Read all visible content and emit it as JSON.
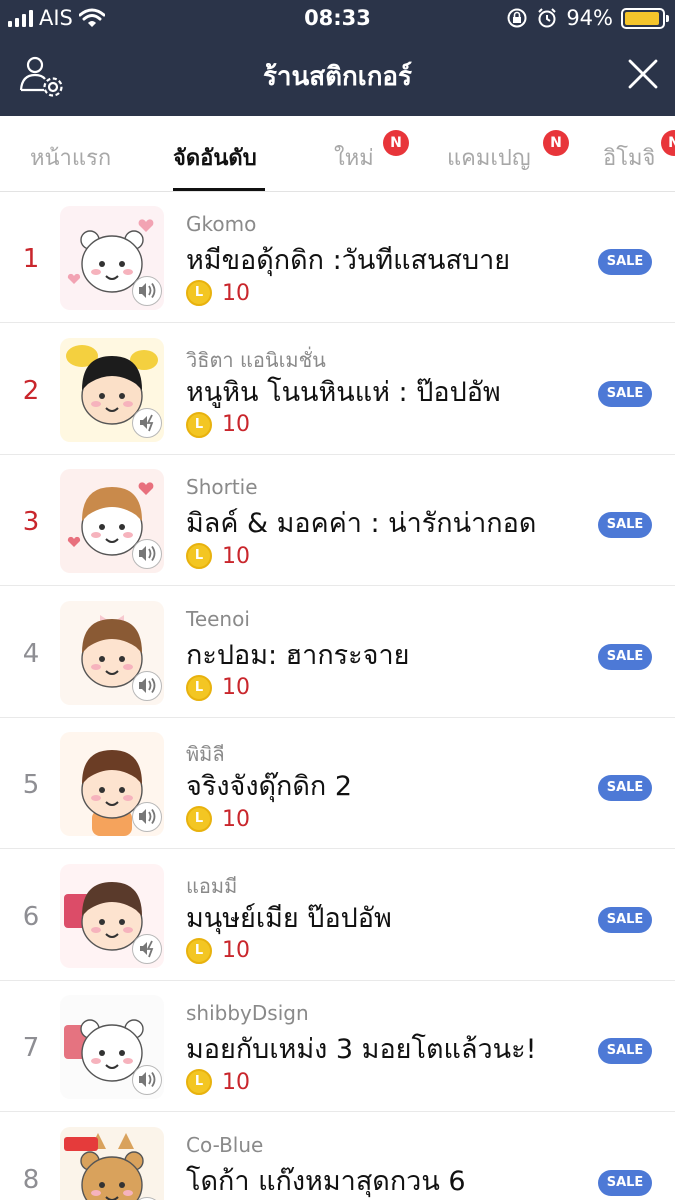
{
  "status_bar": {
    "carrier": "AIS",
    "time": "08:33",
    "battery_percent_label": "94%",
    "battery_level": 0.94,
    "icons": [
      "signal-icon",
      "wifi-icon",
      "orientation-lock-icon",
      "alarm-icon",
      "battery-icon"
    ]
  },
  "header": {
    "title": "ร้านสติกเกอร์",
    "left_icon": "user-settings-icon",
    "right_icon": "close-icon"
  },
  "tabs": [
    {
      "label": "หน้าแรก",
      "active": false,
      "badge": ""
    },
    {
      "label": "จัดอันดับ",
      "active": true,
      "badge": ""
    },
    {
      "label": "ใหม่",
      "active": false,
      "badge": "N"
    },
    {
      "label": "แคมเปญ",
      "active": false,
      "badge": "N"
    },
    {
      "label": "อิโมจิ",
      "active": false,
      "badge": "N"
    }
  ],
  "ranking": [
    {
      "rank": "1",
      "author": "Gkomo",
      "name": "หมีขอดุ้กดิก :วันทีแสนสบาย",
      "price": "10",
      "sale": "SALE",
      "sound_icon": "sound-icon"
    },
    {
      "rank": "2",
      "author": "วิธิตา แอนิเมชั่น",
      "name": "หนูหิน โนนหินแห่ : ป๊อปอัพ",
      "price": "10",
      "sale": "SALE",
      "sound_icon": "popup-sound-icon"
    },
    {
      "rank": "3",
      "author": "Shortie",
      "name": "มิลค์ & มอคค่า : น่ารักน่ากอด",
      "price": "10",
      "sale": "SALE",
      "sound_icon": "sound-icon"
    },
    {
      "rank": "4",
      "author": "Teenoi",
      "name": "กะปอม: ฮากระจาย",
      "price": "10",
      "sale": "SALE",
      "sound_icon": "sound-icon"
    },
    {
      "rank": "5",
      "author": "พิมิลี",
      "name": "จริงจังดุ๊กดิก 2",
      "price": "10",
      "sale": "SALE",
      "sound_icon": "sound-icon"
    },
    {
      "rank": "6",
      "author": "แอมมี",
      "name": "มนุษย์เมีย ป๊อปอัพ",
      "price": "10",
      "sale": "SALE",
      "sound_icon": "popup-sound-icon"
    },
    {
      "rank": "7",
      "author": "shibbyDsign",
      "name": "มอยกับเหม่ง 3 มอยโตแล้วนะ!",
      "price": "10",
      "sale": "SALE",
      "sound_icon": "sound-icon"
    },
    {
      "rank": "8",
      "author": "Co-Blue",
      "name": "โดก้า แก๊งหมาสุดกวน 6",
      "price": "10",
      "sale": "SALE",
      "sound_icon": "sound-icon"
    }
  ],
  "colors": {
    "header_bg": "#2b3449",
    "rank_top": "#c9262c",
    "rank_other": "#8e8e93",
    "sale_badge": "#4d79d6",
    "new_badge": "#e8353a",
    "coin": "#f3c623"
  }
}
